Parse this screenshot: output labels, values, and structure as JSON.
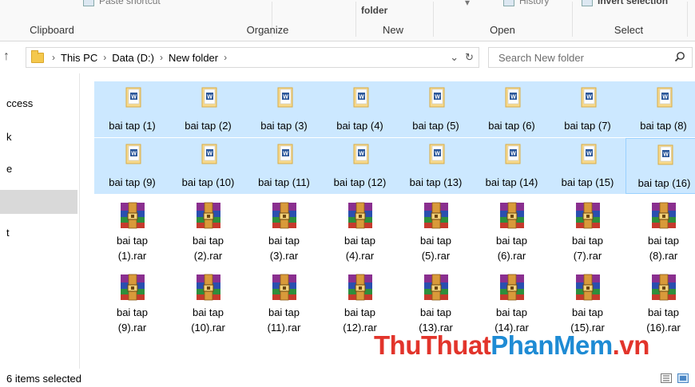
{
  "ribbon": {
    "partial_top": [
      "Paste shortcut",
      "folder",
      "History",
      "Invert selection"
    ],
    "groups": [
      "Clipboard",
      "Organize",
      "New",
      "Open",
      "Select"
    ]
  },
  "address": {
    "crumbs": [
      "This PC",
      "Data (D:)",
      "New folder"
    ],
    "search_placeholder": "Search New folder"
  },
  "nav": {
    "items": [
      "ccess",
      "k",
      "e",
      "t"
    ]
  },
  "docs": [
    {
      "label": "bai tap (1)",
      "selected": true
    },
    {
      "label": "bai tap (2)",
      "selected": true
    },
    {
      "label": "bai tap (3)",
      "selected": true
    },
    {
      "label": "bai tap (4)",
      "selected": true
    },
    {
      "label": "bai tap (5)",
      "selected": true
    },
    {
      "label": "bai tap (6)",
      "selected": true
    },
    {
      "label": "bai tap (7)",
      "selected": true
    },
    {
      "label": "bai tap (8)",
      "selected": true
    },
    {
      "label": "bai tap (9)",
      "selected": true
    },
    {
      "label": "bai tap (10)",
      "selected": true
    },
    {
      "label": "bai tap (11)",
      "selected": true
    },
    {
      "label": "bai tap (12)",
      "selected": true
    },
    {
      "label": "bai tap (13)",
      "selected": true
    },
    {
      "label": "bai tap (14)",
      "selected": true
    },
    {
      "label": "bai tap (15)",
      "selected": true
    },
    {
      "label": "bai tap (16)",
      "selected": true,
      "focused": true
    }
  ],
  "rars": [
    {
      "line1": "bai tap",
      "line2": "(1).rar"
    },
    {
      "line1": "bai tap",
      "line2": "(2).rar"
    },
    {
      "line1": "bai tap",
      "line2": "(3).rar"
    },
    {
      "line1": "bai tap",
      "line2": "(4).rar"
    },
    {
      "line1": "bai tap",
      "line2": "(5).rar"
    },
    {
      "line1": "bai tap",
      "line2": "(6).rar"
    },
    {
      "line1": "bai tap",
      "line2": "(7).rar"
    },
    {
      "line1": "bai tap",
      "line2": "(8).rar"
    },
    {
      "line1": "bai tap",
      "line2": "(9).rar"
    },
    {
      "line1": "bai tap",
      "line2": "(10).rar"
    },
    {
      "line1": "bai tap",
      "line2": "(11).rar"
    },
    {
      "line1": "bai tap",
      "line2": "(12).rar"
    },
    {
      "line1": "bai tap",
      "line2": "(13).rar"
    },
    {
      "line1": "bai tap",
      "line2": "(14).rar"
    },
    {
      "line1": "bai tap",
      "line2": "(15).rar"
    },
    {
      "line1": "bai tap",
      "line2": "(16).rar"
    }
  ],
  "watermark": {
    "part1": "ThuThuat",
    "part2": "PhanMem",
    "part3": ".vn"
  },
  "status": {
    "text": "6 items selected"
  },
  "colors": {
    "selection": "#cce8ff",
    "selection_border": "#99d1ff",
    "watermark_red": "#e2342b",
    "watermark_blue": "#1e8bd4"
  }
}
